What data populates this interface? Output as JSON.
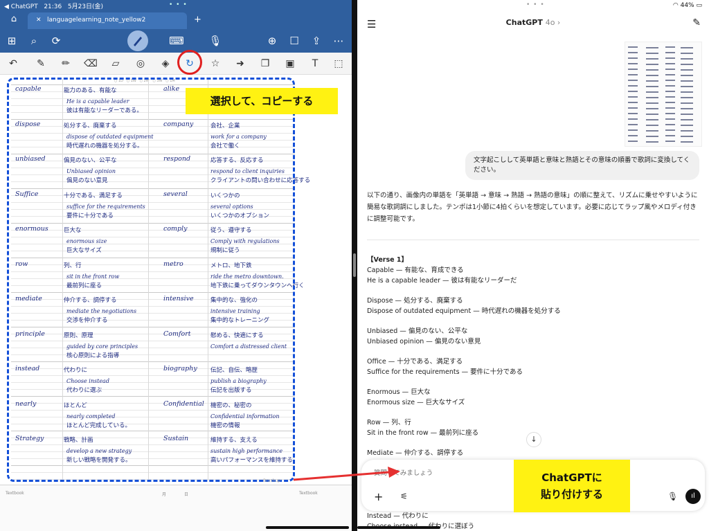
{
  "left_app": {
    "status": {
      "back": "◀ ChatGPT",
      "time": "21:36",
      "date": "5月23日(金)"
    },
    "tab": {
      "home_icon": "home-icon",
      "title": "languagelearning_note_yellow2",
      "close": "✕",
      "add": "+"
    },
    "toolbar_icons": [
      "undo-icon",
      "pen-icon",
      "pencil-icon",
      "eraser-icon",
      "highlighter-icon",
      "shape-icon",
      "image-crop-icon",
      "lasso-icon",
      "sticker-icon",
      "laser-icon",
      "copy-icon",
      "image-icon",
      "text-icon",
      "search-page-icon",
      "select-icon"
    ],
    "callout": "選択して、コピーする",
    "notes": [
      {
        "word": "capable",
        "meaning": "能力のある、有能な",
        "phrase": "He is a capable leader",
        "phrase_ja": "彼は有能なリーダーである。",
        "word2": "alike",
        "meaning2": "",
        "phrase2": "",
        "phrase2_ja": ""
      },
      {
        "word": "dispose",
        "meaning": "処分する、廃棄する",
        "phrase": "dispose of outdated equipment",
        "phrase_ja": "時代遅れの機器を処分する。",
        "word2": "company",
        "meaning2": "会社、企業",
        "phrase2": "work for a company",
        "phrase2_ja": "会社で働く"
      },
      {
        "word": "unbiased",
        "meaning": "偏見のない、公平な",
        "phrase": "Unbiased opinion",
        "phrase_ja": "偏見のない意見",
        "word2": "respond",
        "meaning2": "応答する、反応する",
        "phrase2": "respond to client inquiries",
        "phrase2_ja": "クライアントの問い合わせに応答する"
      },
      {
        "word": "Suffice",
        "meaning": "十分である、満足する",
        "phrase": "suffice for the requirements",
        "phrase_ja": "要件に十分である",
        "word2": "several",
        "meaning2": "いくつかの",
        "phrase2": "several options",
        "phrase2_ja": "いくつかのオプション"
      },
      {
        "word": "enormous",
        "meaning": "巨大な",
        "phrase": "enormous size",
        "phrase_ja": "巨大なサイズ",
        "word2": "comply",
        "meaning2": "従う、遵守する",
        "phrase2": "Comply with regulations",
        "phrase2_ja": "規制に従う"
      },
      {
        "word": "row",
        "meaning": "列、行",
        "phrase": "sit in the front row",
        "phrase_ja": "最前列に座る",
        "word2": "metro",
        "meaning2": "メトロ、地下鉄",
        "phrase2": "ride the metro downtown.",
        "phrase2_ja": "地下鉄に乗ってダウンタウンへ行く"
      },
      {
        "word": "mediate",
        "meaning": "仲介する、調停する",
        "phrase": "mediate the negotiations",
        "phrase_ja": "交渉を仲介する",
        "word2": "intensive",
        "meaning2": "集中的な、強化の",
        "phrase2": "intensive training",
        "phrase2_ja": "集中的なトレーニング"
      },
      {
        "word": "principle",
        "meaning": "原則、原理",
        "phrase": "guided by core principles",
        "phrase_ja": "核心原則による指導",
        "word2": "Comfort",
        "meaning2": "慰める、快適にする",
        "phrase2": "Comfort a distressed client",
        "phrase2_ja": ""
      },
      {
        "word": "instead",
        "meaning": "代わりに",
        "phrase": "Choose instead",
        "phrase_ja": "代わりに選ぶ",
        "word2": "biography",
        "meaning2": "伝記、自伝、略歴",
        "phrase2": "publish a biography",
        "phrase2_ja": "伝記を出版する"
      },
      {
        "word": "nearly",
        "meaning": "ほとんど",
        "phrase": "nearly completed",
        "phrase_ja": "ほとんど完成している。",
        "word2": "Confidential",
        "meaning2": "機密の、秘密の",
        "phrase2": "Confidential information",
        "phrase2_ja": "機密の情報"
      },
      {
        "word": "Strategy",
        "meaning": "戦略、計画",
        "phrase": "develop a new strategy",
        "phrase_ja": "新しい戦略を開発する。",
        "word2": "Sustain",
        "meaning2": "維持する、支える",
        "phrase2": "sustain high performance",
        "phrase2_ja": "高いパフォーマンスを維持する。"
      }
    ],
    "bottom_labels": [
      "Textbook",
      "月",
      "日",
      "Textbook"
    ],
    "watermark": "Brushup"
  },
  "right_app": {
    "status": {
      "wifi": "wifi-icon",
      "battery": "44%"
    },
    "header": {
      "title": "ChatGPT",
      "model": "4o ›"
    },
    "user_message": "文字起こしして英単語と意味と熟語とその意味の順番で歌詞に変換してください。",
    "intro": "以下の通り、画像内の単語を「英単語 → 意味 → 熟語 → 熟語の意味」の順に整えて、リズムに乗せやすいように簡易な歌詞調にしました。テンポは1小節に4拍くらいを想定しています。必要に応じてラップ風やメロディ付きに調整可能です。",
    "verse_title": "【Verse 1】",
    "lines": [
      [
        "Capable — 有能な、育成できる",
        "He is a capable leader — 彼は有能なリーダーだ"
      ],
      [
        "Dispose — 処分する、廃棄する",
        "Dispose of outdated equipment — 時代遅れの機器を処分する"
      ],
      [
        "Unbiased — 偏見のない、公平な",
        "Unbiased opinion — 偏見のない意見"
      ],
      [
        "Office — 十分である、満足する",
        "Suffice for the requirements — 要件に十分である"
      ],
      [
        "Enormous — 巨大な",
        "Enormous size — 巨大なサイズ"
      ],
      [
        "Row — 列、行",
        "Sit in the front row — 最前列に座る"
      ],
      [
        "Mediate — 仲介する、調停する"
      ]
    ],
    "composer_placeholder": "質問してみましょう",
    "callout": [
      "ChatGPTに",
      "貼り付けする"
    ],
    "tail": [
      "Instead — 代わりに",
      "Choose instead — 代わりに選ぼう"
    ]
  }
}
